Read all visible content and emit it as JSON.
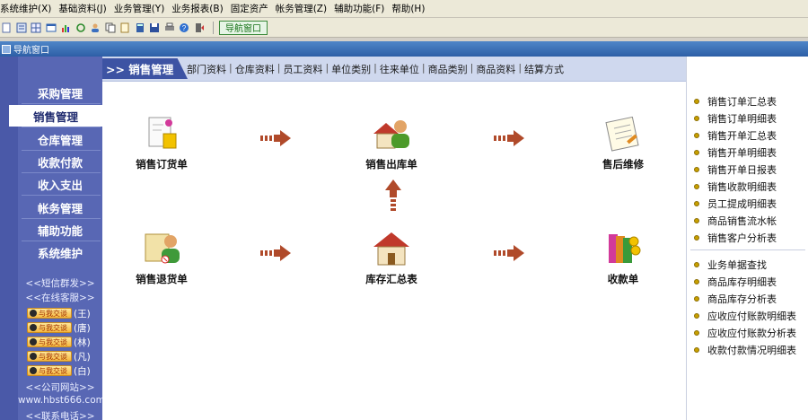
{
  "menu": [
    "系统维护(X)",
    "基础资料(J)",
    "业务管理(Y)",
    "业务报表(B)",
    "固定资产",
    "帐务管理(Z)",
    "辅助功能(F)",
    "帮助(H)"
  ],
  "toolbar": {
    "nav_window_label": "导航窗口"
  },
  "nav_window": {
    "title": "导航窗口"
  },
  "sidebar": {
    "items": [
      "采购管理",
      "销售管理",
      "仓库管理",
      "收款付款",
      "收入支出",
      "帐务管理",
      "辅助功能",
      "系统维护"
    ],
    "active_index": 1,
    "sms": "<<短信群发>>",
    "service": "<<在线客服>>",
    "qq_label": "与我交谈",
    "qq_contacts": [
      "(王)",
      "(唐)",
      "(林)",
      "(凡)",
      "(白)"
    ],
    "website_label": "<<公司网站>>",
    "website": "www.hbst666.com",
    "phone_label": "<<联系电话>>"
  },
  "main": {
    "title": ">> 销售管理",
    "links": [
      "部门资料",
      "仓库资料",
      "员工资料",
      "单位类别",
      "往来单位",
      "商品类别",
      "商品资料",
      "结算方式"
    ],
    "flow": {
      "order": "销售订货单",
      "outbound": "销售出库单",
      "after_sale": "售后维修",
      "return": "销售退货单",
      "inventory": "库存汇总表",
      "receipt": "收款单"
    }
  },
  "right": {
    "group1": [
      "销售订单汇总表",
      "销售订单明细表",
      "销售开单汇总表",
      "销售开单明细表",
      "销售开单日报表",
      "销售收款明细表",
      "员工提成明细表",
      "商品销售流水帐",
      "销售客户分析表"
    ],
    "group2": [
      "业务单据查找",
      "商品库存明细表",
      "商品库存分析表",
      "应收应付账款明细表",
      "应收应付账款分析表",
      "收款付款情况明细表"
    ]
  }
}
